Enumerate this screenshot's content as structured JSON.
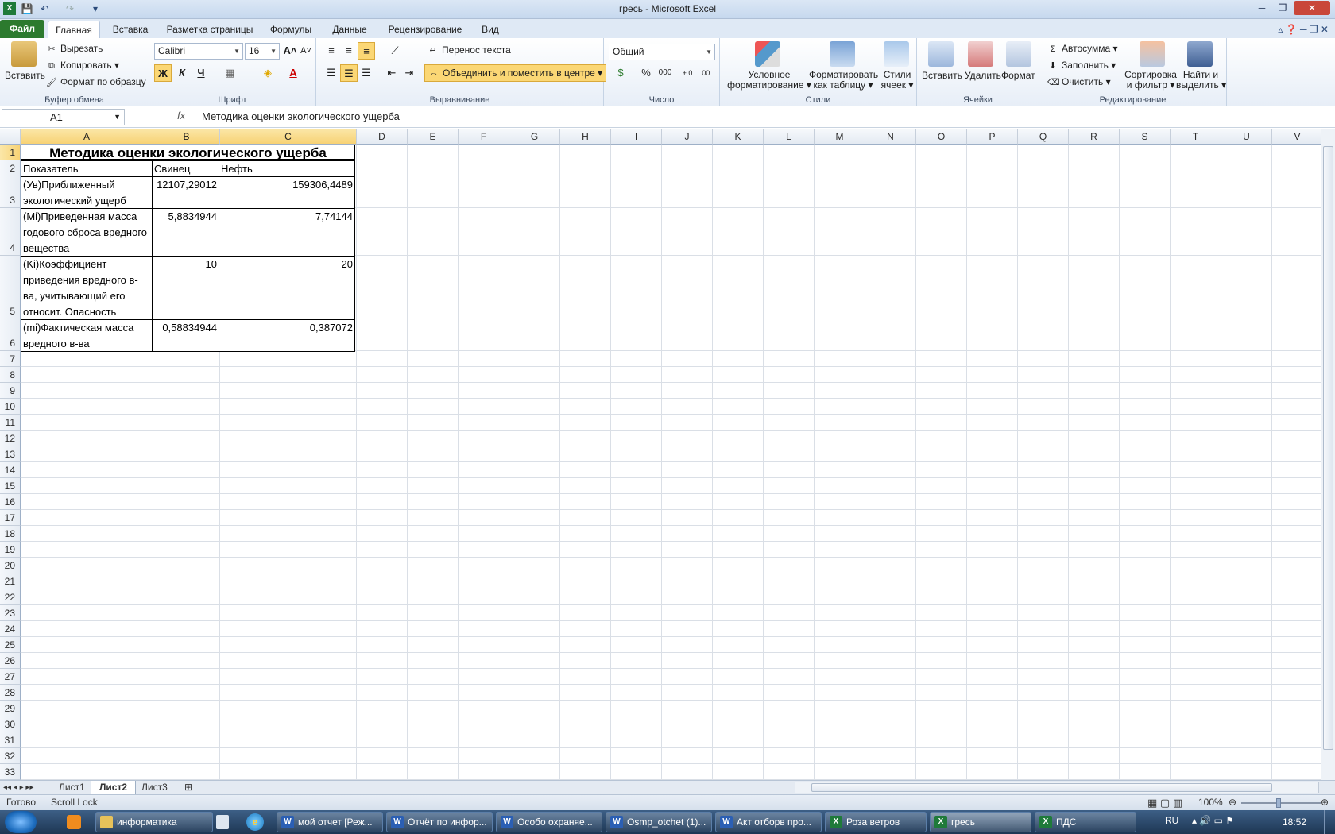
{
  "window": {
    "title": "гресь  -  Microsoft Excel"
  },
  "ribbon_tabs": [
    "Файл",
    "Главная",
    "Вставка",
    "Разметка страницы",
    "Формулы",
    "Данные",
    "Рецензирование",
    "Вид"
  ],
  "clipboard": {
    "paste": "Вставить",
    "cut": "Вырезать",
    "copy": "Копировать",
    "format_painter": "Формат по образцу",
    "label": "Буфер обмена"
  },
  "font": {
    "name": "Calibri",
    "size": "16",
    "bold": "Ж",
    "italic": "К",
    "underline": "Ч",
    "label": "Шрифт"
  },
  "alignment": {
    "wrap": "Перенос текста",
    "merge": "Объединить и поместить в центре",
    "label": "Выравнивание"
  },
  "number": {
    "format": "Общий",
    "label": "Число",
    "percent": "%",
    "thousands": "000"
  },
  "styles": {
    "conditional_1": "Условное",
    "conditional_2": "форматирование",
    "table_1": "Форматировать",
    "table_2": "как таблицу",
    "cell_1": "Стили",
    "cell_2": "ячеек",
    "label": "Стили"
  },
  "cells": {
    "insert": "Вставить",
    "delete": "Удалить",
    "format": "Формат",
    "label": "Ячейки"
  },
  "editing": {
    "autosum": "Автосумма",
    "fill": "Заполнить",
    "clear": "Очистить",
    "sort_1": "Сортировка",
    "sort_2": "и фильтр",
    "find_1": "Найти и",
    "find_2": "выделить",
    "label": "Редактирование"
  },
  "formula_bar": {
    "name_box": "A1",
    "fx": "fx",
    "formula": "Методика оценки экологического ущерба"
  },
  "columns": [
    "A",
    "B",
    "C",
    "D",
    "E",
    "F",
    "G",
    "H",
    "I",
    "J",
    "K",
    "L",
    "M",
    "N",
    "O",
    "P",
    "Q",
    "R",
    "S",
    "T",
    "U",
    "V"
  ],
  "rows": [
    "1",
    "2",
    "3",
    "4",
    "5",
    "6",
    "7",
    "8",
    "9",
    "10",
    "11",
    "12",
    "13",
    "14",
    "15",
    "16",
    "17",
    "18",
    "19",
    "20",
    "21",
    "22",
    "23",
    "24",
    "25",
    "26",
    "27",
    "28",
    "29",
    "30",
    "31",
    "32",
    "33"
  ],
  "table": {
    "title": "Методика оценки экологического ущерба",
    "headers": [
      "Показатель",
      "Свинец",
      "Нефть"
    ],
    "rows": [
      {
        "label": "(Ув)Приближенный экологический ущерб",
        "b": "12107,29012",
        "c": "159306,4489"
      },
      {
        "label": "(Mi)Приведенная масса годового сброса вредного вещества",
        "b": "5,8834944",
        "c": "7,74144"
      },
      {
        "label": "(Ki)Коэффициент приведения вредного в-ва, учитывающий его относит. Опасность",
        "b": "10",
        "c": "20"
      },
      {
        "label": "(mi)Фактическая масса вредного в-ва",
        "b": "0,58834944",
        "c": "0,387072"
      }
    ]
  },
  "sheet_tabs": [
    "Лист1",
    "Лист2",
    "Лист3"
  ],
  "status": {
    "ready": "Готово",
    "scroll_lock": "Scroll Lock",
    "zoom": "100%"
  },
  "taskbar": {
    "items": [
      "информатика",
      "мой отчет [Реж...",
      "Отчёт по инфор...",
      "Особо охраняе...",
      "Osmp_otchet (1)...",
      "Акт отборв про...",
      "Роза ветров",
      "гресь",
      "ПДС"
    ],
    "lang": "RU",
    "time": "18:52"
  }
}
